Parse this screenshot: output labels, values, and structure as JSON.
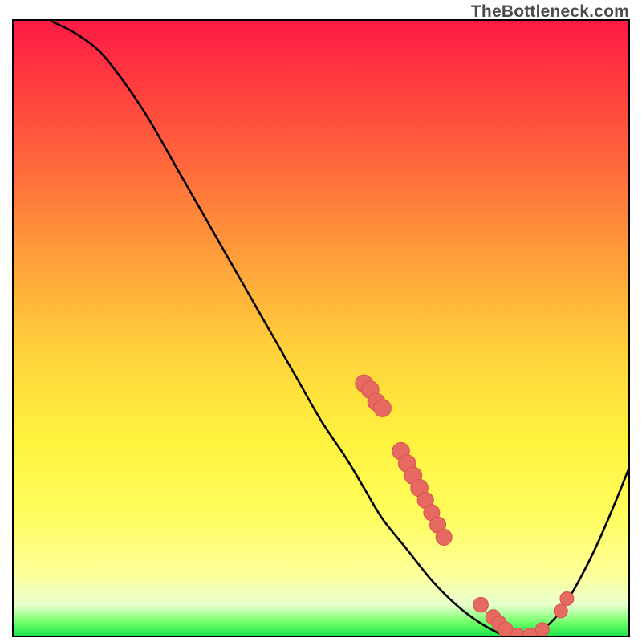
{
  "watermark": "TheBottleneck.com",
  "colors": {
    "frame": "#000000",
    "curve": "#000000",
    "marker_fill": "#e66a62",
    "marker_stroke": "#d9564e"
  },
  "chart_data": {
    "type": "line",
    "title": "",
    "xlabel": "",
    "ylabel": "",
    "xlim": [
      0,
      100
    ],
    "ylim": [
      0,
      100
    ],
    "grid": false,
    "legend": false,
    "axes_ticks_visible": false,
    "note": "Axes have no visible tick labels in the image; x/y values below are estimated in percent of the axis range based on pixel positions and gradient.",
    "series": [
      {
        "name": "curve",
        "x": [
          6,
          10,
          14,
          18,
          22,
          26,
          30,
          34,
          38,
          42,
          46,
          50,
          54,
          57,
          60,
          64,
          68,
          72,
          76,
          80,
          83,
          86,
          89,
          92,
          95,
          98,
          100
        ],
        "values": [
          100,
          98,
          95,
          90,
          84,
          77,
          70,
          63,
          56,
          49,
          42,
          35,
          29,
          24,
          19,
          14,
          9,
          5,
          2,
          0,
          0,
          1,
          4,
          9,
          15,
          22,
          27
        ]
      }
    ],
    "markers": [
      {
        "x": 57,
        "y": 41,
        "r": 1.4
      },
      {
        "x": 58,
        "y": 40,
        "r": 1.4
      },
      {
        "x": 59,
        "y": 38,
        "r": 1.4
      },
      {
        "x": 60,
        "y": 37,
        "r": 1.4
      },
      {
        "x": 63,
        "y": 30,
        "r": 1.4
      },
      {
        "x": 64,
        "y": 28,
        "r": 1.4
      },
      {
        "x": 65,
        "y": 26,
        "r": 1.4
      },
      {
        "x": 66,
        "y": 24,
        "r": 1.4
      },
      {
        "x": 67,
        "y": 22,
        "r": 1.3
      },
      {
        "x": 68,
        "y": 20,
        "r": 1.3
      },
      {
        "x": 69,
        "y": 18,
        "r": 1.3
      },
      {
        "x": 70,
        "y": 16,
        "r": 1.3
      },
      {
        "x": 76,
        "y": 5,
        "r": 1.2
      },
      {
        "x": 78,
        "y": 3,
        "r": 1.2
      },
      {
        "x": 79,
        "y": 2,
        "r": 1.2
      },
      {
        "x": 80,
        "y": 1,
        "r": 1.2
      },
      {
        "x": 82,
        "y": 0,
        "r": 1.2
      },
      {
        "x": 84,
        "y": 0,
        "r": 1.2
      },
      {
        "x": 86,
        "y": 1,
        "r": 1.1
      },
      {
        "x": 89,
        "y": 4,
        "r": 1.1
      },
      {
        "x": 90,
        "y": 6,
        "r": 1.1
      }
    ]
  }
}
